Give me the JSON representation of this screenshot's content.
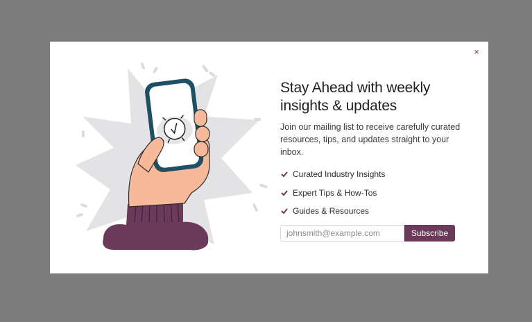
{
  "modal": {
    "close_label": "×",
    "title": "Stay Ahead with weekly insights & updates",
    "description": "Join our mailing list to receive carefully curated resources, tips, and updates straight to your inbox.",
    "features": [
      {
        "label": "Curated Industry Insights",
        "icon": "check-icon"
      },
      {
        "label": "Expert Tips & How-Tos",
        "icon": "check-icon"
      },
      {
        "label": "Guides & Resources",
        "icon": "check-icon"
      }
    ],
    "email_placeholder": "johnsmith@example.com",
    "email_value": "",
    "subscribe_label": "Subscribe"
  },
  "colors": {
    "overlay": "#7d7d7d",
    "accent": "#6b3a5a",
    "phone_frame": "#1f4f63",
    "skin": "#f6b99a",
    "sleeve": "#6b3a5a",
    "burst": "#e3e3e6"
  }
}
